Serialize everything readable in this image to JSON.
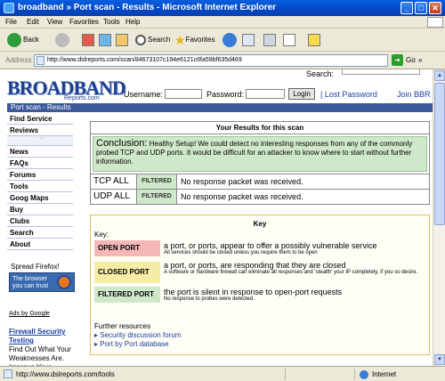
{
  "window": {
    "title": "broadband » Port scan - Results - Microsoft Internet Explorer",
    "min": "_",
    "max": "□",
    "close": "✕"
  },
  "menu": {
    "file": "File",
    "edit": "Edit",
    "view": "View",
    "favorites": "Favorites",
    "tools": "Tools",
    "help": "Help"
  },
  "toolbar": {
    "back": "Back",
    "search": "Search",
    "favorites": "Favorites"
  },
  "address": {
    "label": "Address",
    "url": "http://www.dslreports.com/scan/84673107c194e6121c6fa59bf635d469",
    "go": "Go",
    "links": "»"
  },
  "site": {
    "search_label": "Search:",
    "logo_big": "BROADBAND",
    "logo_small": "Reports.com",
    "username_label": "Username:",
    "password_label": "Password:",
    "login_button": "Login",
    "lost_password": "| Lost Password",
    "bbr": "Join BBR",
    "crumb": "Port scan - Results"
  },
  "sidebar": {
    "items": [
      "Find Service",
      "Reviews",
      "",
      "News",
      "FAQs",
      "Forums",
      "Tools",
      "Goog Maps",
      "Buy",
      "Clubs",
      "Search",
      "About"
    ],
    "dots": "··",
    "spread": "Spread Firefox!",
    "ff_badge": "The browser you can trust",
    "ads": "Ads by Google",
    "firewall_link": "Firewall Security Testing",
    "firewall_text": "Find Out What Your Weaknesses Are. Improve Your"
  },
  "results": {
    "header": "Your Results for this scan",
    "conclusion_title": "Conclusion:",
    "conclusion_text": "Healthy Setup! We could detect no interesting responses from any of the commonly probed TCP and UDP ports. It would be difficult for an attacker to know where to start without further information.",
    "rows": [
      {
        "proto": "TCP ALL",
        "status": "FILTERED",
        "detail": "No response packet was received."
      },
      {
        "proto": "UDP ALL",
        "status": "FILTERED",
        "detail": "No response packet was received."
      }
    ]
  },
  "key": {
    "title": "Key",
    "label": "Key:",
    "entries": [
      {
        "badge": "OPEN PORT",
        "desc": "a port, or ports, appear to offer a possibly vulnerable service",
        "sub": "All services should be closed unless you require them to be open",
        "color": "#f6b7b7"
      },
      {
        "badge": "CLOSED PORT",
        "desc": "a port, or ports, are responding that they are closed",
        "sub": "A software or hardware firewall can eliminate all responses and 'stealth' your IP completely, if you so desire.",
        "color": "#f5eca5"
      },
      {
        "badge": "FILTERED PORT",
        "desc": "the port is silent in response to open-port requests",
        "sub": "No response to probes were detected.",
        "color": "#cfe8c9"
      }
    ],
    "further": "Further resources",
    "link1": "▸ Security discussion forum",
    "link2": "▸ Port by Port database"
  },
  "status": {
    "url": "http://www.dslreports.com/tools",
    "zone": "Internet"
  }
}
